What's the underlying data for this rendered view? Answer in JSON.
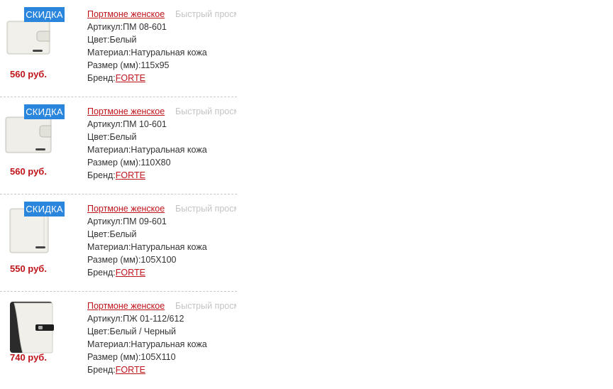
{
  "products": [
    {
      "badge": "СКИДКА",
      "price": "560 руб.",
      "title": "Портмоне женское",
      "quick_view": "Быстрый просмотр",
      "article_label": "Артикул:",
      "article": "ПМ 08-601",
      "color_label": "Цвет:",
      "color": "Белый",
      "material_label": "Материал:",
      "material": "Натуральная кожа",
      "size_label": "Размер (мм):",
      "size": "115x95",
      "brand_label": "Бренд:",
      "brand": "FORTE",
      "image_icon": "wallet-white-closed-icon"
    },
    {
      "badge": "СКИДКА",
      "price": "560 руб.",
      "title": "Портмоне женское",
      "quick_view": "Быстрый просмотр",
      "article_label": "Артикул:",
      "article": "ПМ 10-601",
      "color_label": "Цвет:",
      "color": "Белый",
      "material_label": "Материал:",
      "material": "Натуральная кожа",
      "size_label": "Размер (мм):",
      "size": "110X80",
      "brand_label": "Бренд:",
      "brand": "FORTE",
      "image_icon": "wallet-white-closed-icon"
    },
    {
      "badge": "СКИДКА",
      "price": "550 руб.",
      "title": "Портмоне женское",
      "quick_view": "Быстрый просмотр",
      "article_label": "Артикул:",
      "article": "ПМ 09-601",
      "color_label": "Цвет:",
      "color": "Белый",
      "material_label": "Материал:",
      "material": "Натуральная кожа",
      "size_label": "Размер (мм):",
      "size": "105X100",
      "brand_label": "Бренд:",
      "brand": "FORTE",
      "image_icon": "wallet-white-square-icon"
    },
    {
      "badge": "",
      "price": "740 руб.",
      "title": "Портмоне женское",
      "quick_view": "Быстрый просмотр",
      "article_label": "Артикул:",
      "article": "ПЖ 01-112/612",
      "color_label": "Цвет:",
      "color": "Белый / Черный",
      "material_label": "Материал:",
      "material": "Натуральная кожа",
      "size_label": "Размер (мм):",
      "size": "105X110",
      "brand_label": "Бренд:",
      "brand": "FORTE",
      "image_icon": "wallet-black-white-icon"
    }
  ],
  "colors": {
    "accent_red": "#c0141b",
    "badge_blue": "#2a85dd",
    "quick_view_gray": "#c4c4c4"
  }
}
